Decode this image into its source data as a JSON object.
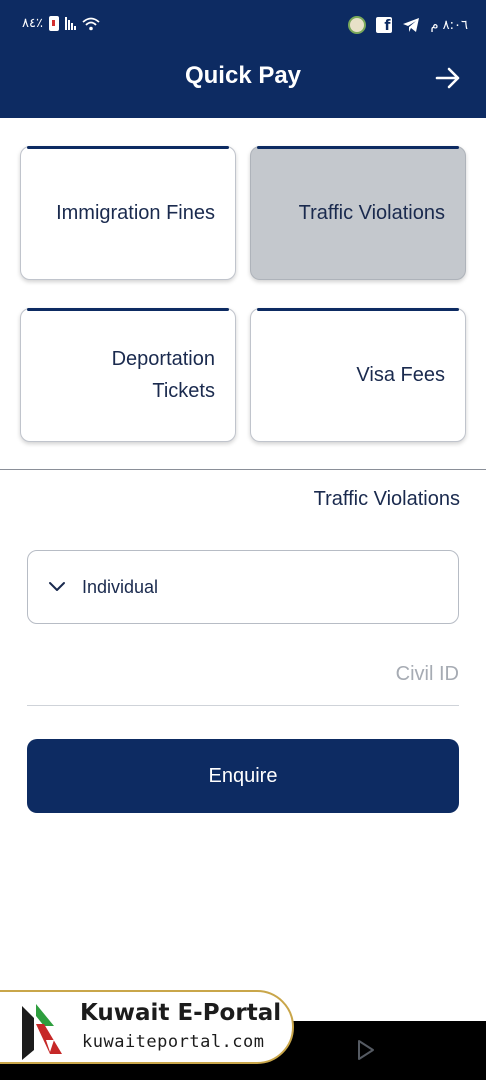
{
  "status_bar": {
    "battery_percent": "٨٤٪",
    "time": "٨:٠٦ م"
  },
  "header": {
    "title": "Quick Pay"
  },
  "services": [
    {
      "label": "Immigration Fines",
      "selected": false
    },
    {
      "label": "Traffic Violations",
      "selected": true
    },
    {
      "label": "Deportation\nTickets",
      "selected": false
    },
    {
      "label": "Visa Fees",
      "selected": false
    }
  ],
  "form": {
    "section_title": "Traffic Violations",
    "type_selected": "Individual",
    "civil_id_value": "",
    "civil_id_placeholder": "Civil ID",
    "submit_label": "Enquire"
  },
  "watermark": {
    "title": "Kuwait E-Portal",
    "url": "kuwaiteportal.com"
  },
  "icons": {
    "forward": "arrow-right-icon",
    "dropdown": "chevron-down-icon",
    "nav_back": "triangle-back-icon"
  },
  "colors": {
    "primary": "#0d2b62",
    "selected_card": "#c4c8cd",
    "watermark_border": "#c9a64a"
  }
}
